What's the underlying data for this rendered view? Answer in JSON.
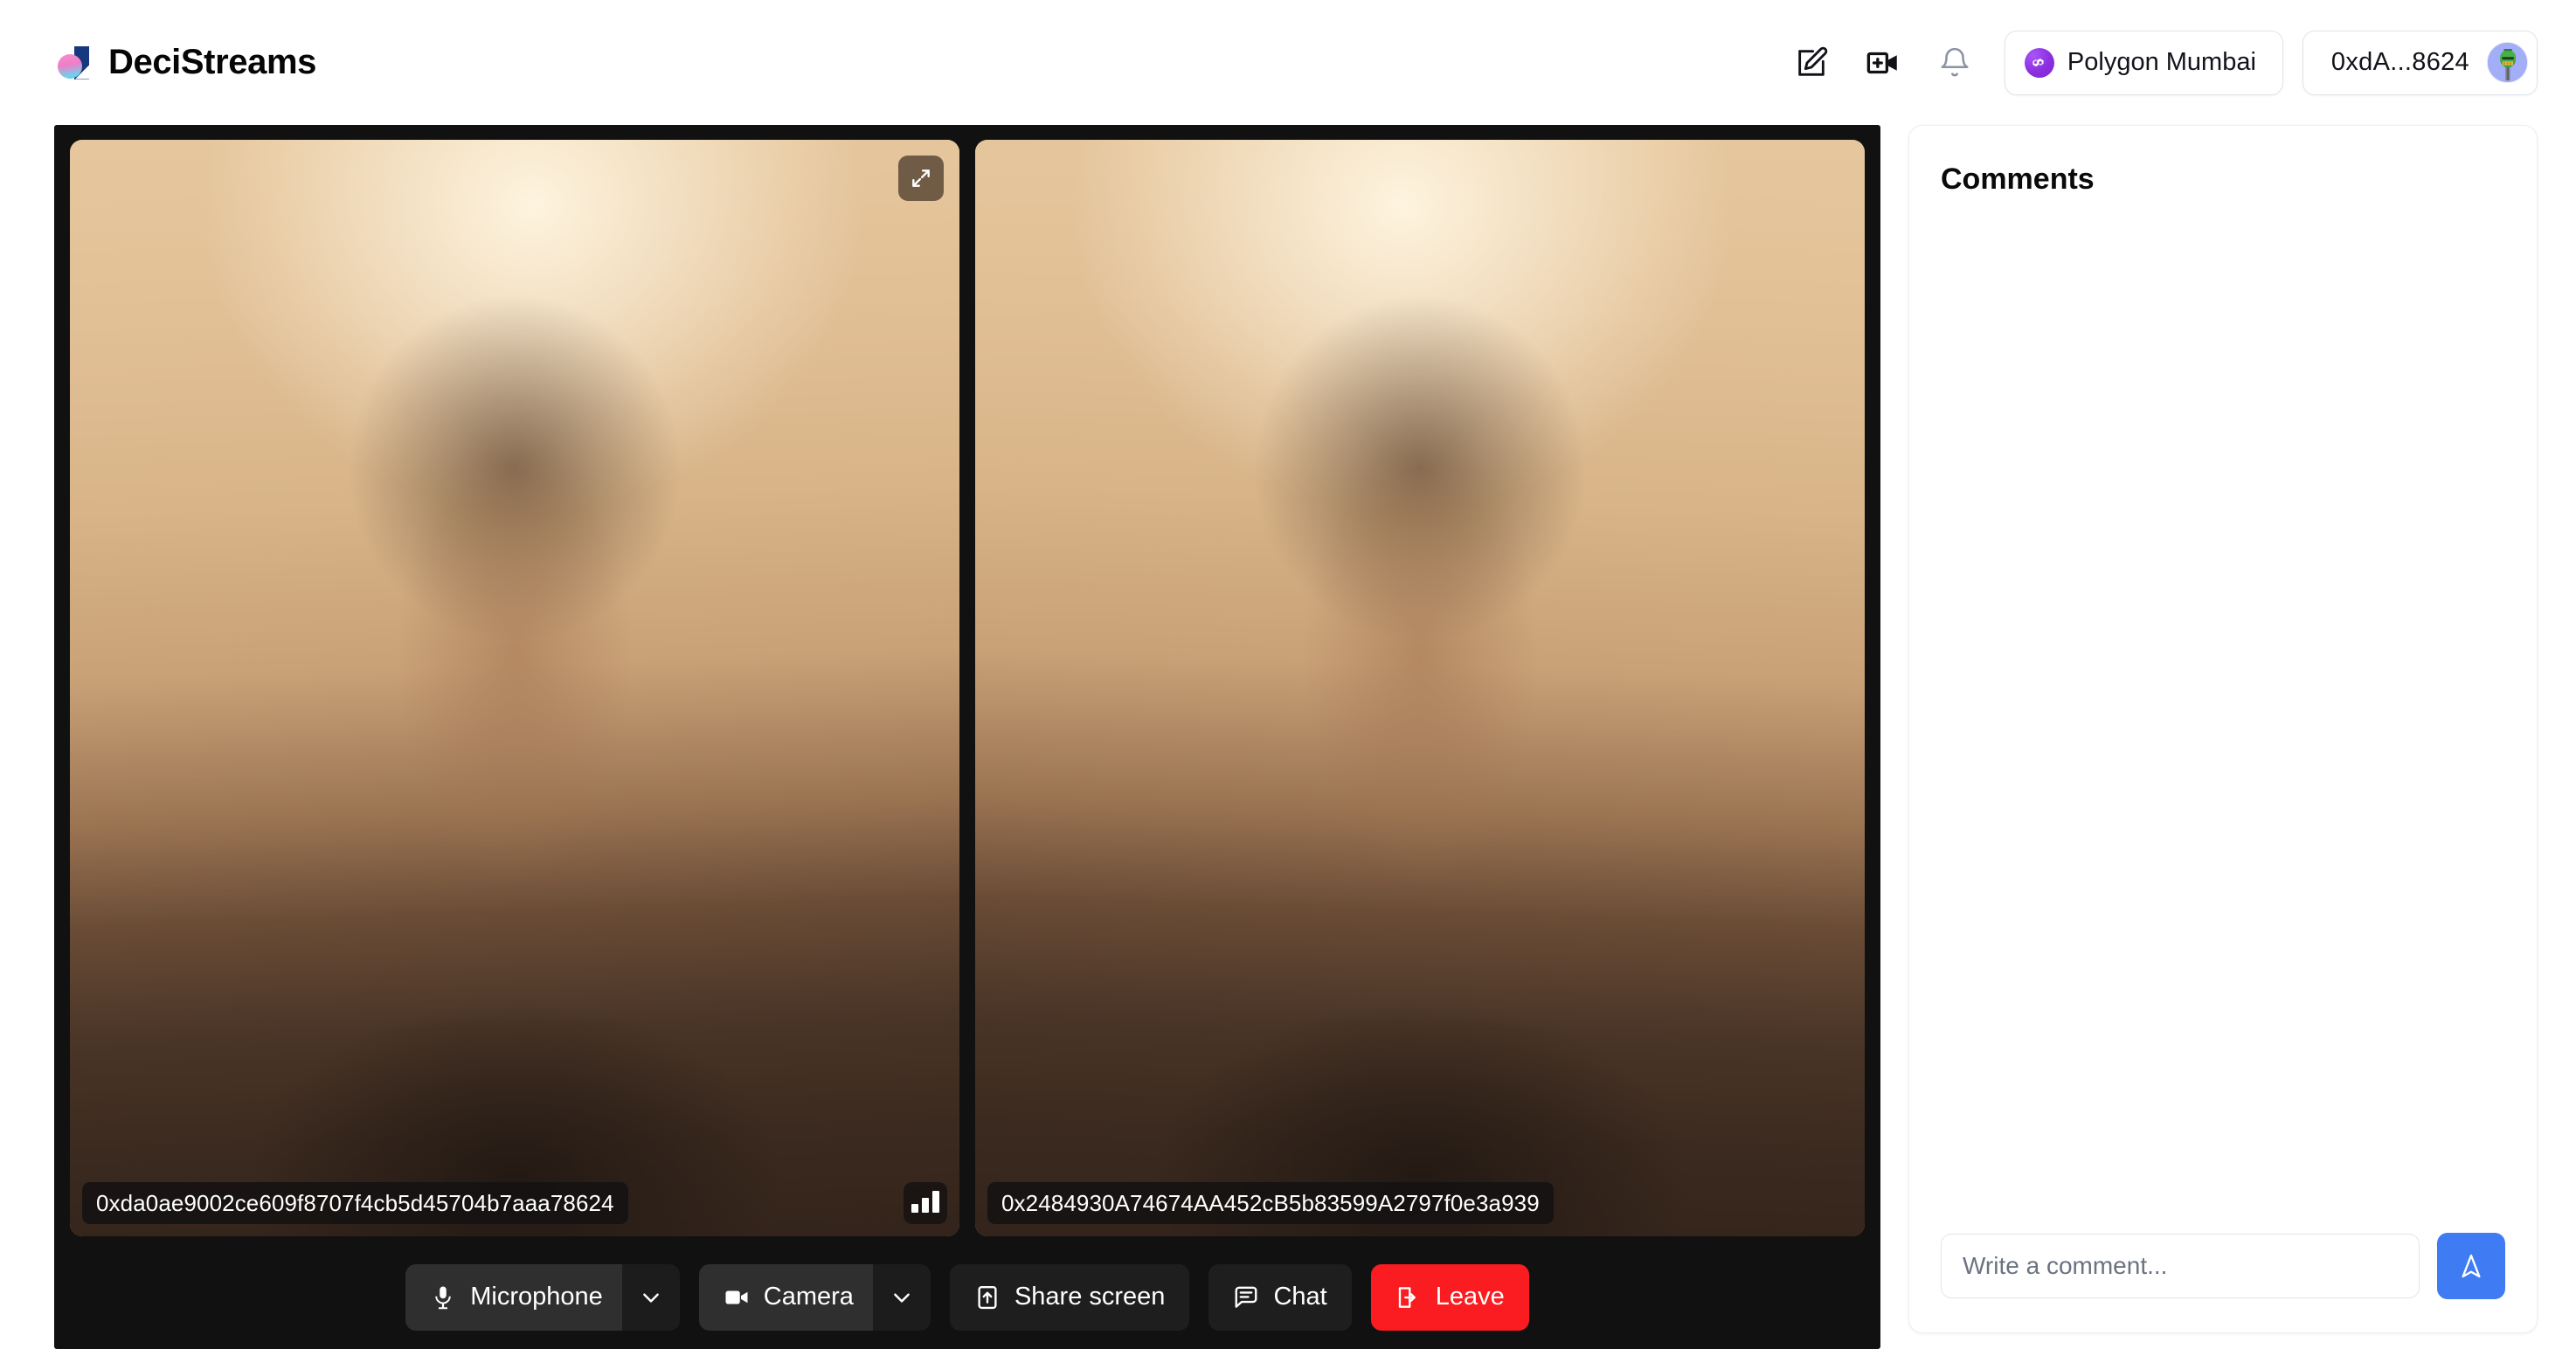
{
  "app": {
    "brand_name": "DeciStreams",
    "logo_icon": "decistreams-logo",
    "accent_blue": "#3f7bf2",
    "danger_red": "#fa1c20",
    "stage_bg": "#111112",
    "polygon_purple": "#8b2fe0"
  },
  "header": {
    "actions": [
      {
        "name": "edit-icon",
        "label": "Edit"
      },
      {
        "name": "video-plus-icon",
        "label": "New meeting"
      },
      {
        "name": "bell-icon",
        "label": "Notifications"
      }
    ],
    "network_chip": {
      "label": "Polygon Mumbai",
      "icon": "polygon-icon"
    },
    "account_chip": {
      "label": "0xdA...8624",
      "avatar_icon": "user-avatar"
    }
  },
  "stage": {
    "tiles": [
      {
        "address": "0xda0ae9002ce609f8707f4cb5d45704b7aaa78624",
        "has_expand": true,
        "expand_icon": "expand-icon",
        "has_signal": true,
        "signal_icon": "signal-bars-icon"
      },
      {
        "address": "0x2484930A74674AA452cB5b83599A2797f0e3a939",
        "has_expand": false,
        "has_signal": false
      }
    ]
  },
  "controls": {
    "microphone": {
      "label": "Microphone",
      "icon": "microphone-icon",
      "caret_icon": "chevron-down-icon"
    },
    "camera": {
      "label": "Camera",
      "icon": "camera-icon",
      "caret_icon": "chevron-down-icon"
    },
    "share_screen": {
      "label": "Share screen",
      "icon": "share-screen-icon"
    },
    "chat": {
      "label": "Chat",
      "icon": "chat-icon"
    },
    "leave": {
      "label": "Leave",
      "icon": "leave-icon"
    }
  },
  "sidebar": {
    "title": "Comments",
    "comments": [],
    "compose": {
      "placeholder": "Write a comment...",
      "value": "",
      "send_icon": "send-icon"
    }
  }
}
